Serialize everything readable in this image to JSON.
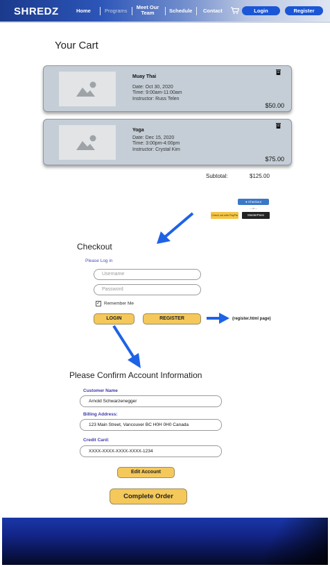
{
  "nav": {
    "logo": "SHREDZ",
    "links": {
      "home": "Home",
      "programs": "Programs",
      "meet_our": "Meet Our",
      "team": "Team",
      "schedule": "Schedule",
      "contact": "Contact"
    },
    "login_label": "Login",
    "register_label": "Register",
    "accent_color": "#1a56d6"
  },
  "cart": {
    "title": "Your Cart",
    "items": [
      {
        "name": "Muay Thai",
        "date": "Date: Oct 30, 2020",
        "time": "Time: 9:00am-11:00am",
        "instructor": "Instructor: Russ Telen",
        "price": "$50.00"
      },
      {
        "name": "Yoga",
        "date": "Date: Dec 15, 2020",
        "time": "Time: 3:00pm-4:00pm",
        "instructor": "Instructor: Crystal Kim",
        "price": "$75.00"
      }
    ],
    "subtotal_label": "Subtotal:",
    "subtotal_value": "$125.00"
  },
  "payment": {
    "checkout_label": "Checkout",
    "or_text": "—or—",
    "paypal_label": "Check out with PayPal",
    "masterpass_label": "MasterPass"
  },
  "checkout": {
    "title": "Checkout",
    "login_hint": "Please Log in",
    "username_placeholder": "Username",
    "password_placeholder": "Password",
    "remember_label": "Remember Me",
    "remember_checked": true,
    "login_button": "LOGIN",
    "register_button": "REGISTER",
    "register_note": "(register.html page)"
  },
  "confirm": {
    "title": "Please Confirm Account Information",
    "customer_name_label": "Customer Name",
    "customer_name_value": "Arnold Schwarzenegger",
    "billing_label": "Billing Address:",
    "billing_value": "123 Main Street, Vancouver BC H0H 0H0 Canada",
    "card_label": "Credit Card:",
    "card_value": "XXXX-XXXX-XXXX-XXXX-1234",
    "edit_button": "Edit Account",
    "complete_button": "Complete Order"
  },
  "colors": {
    "button_yellow": "#f4c85a",
    "arrow_blue": "#1e63e6",
    "label_purple": "#3d3aa8",
    "card_gray": "#c5ced6"
  }
}
